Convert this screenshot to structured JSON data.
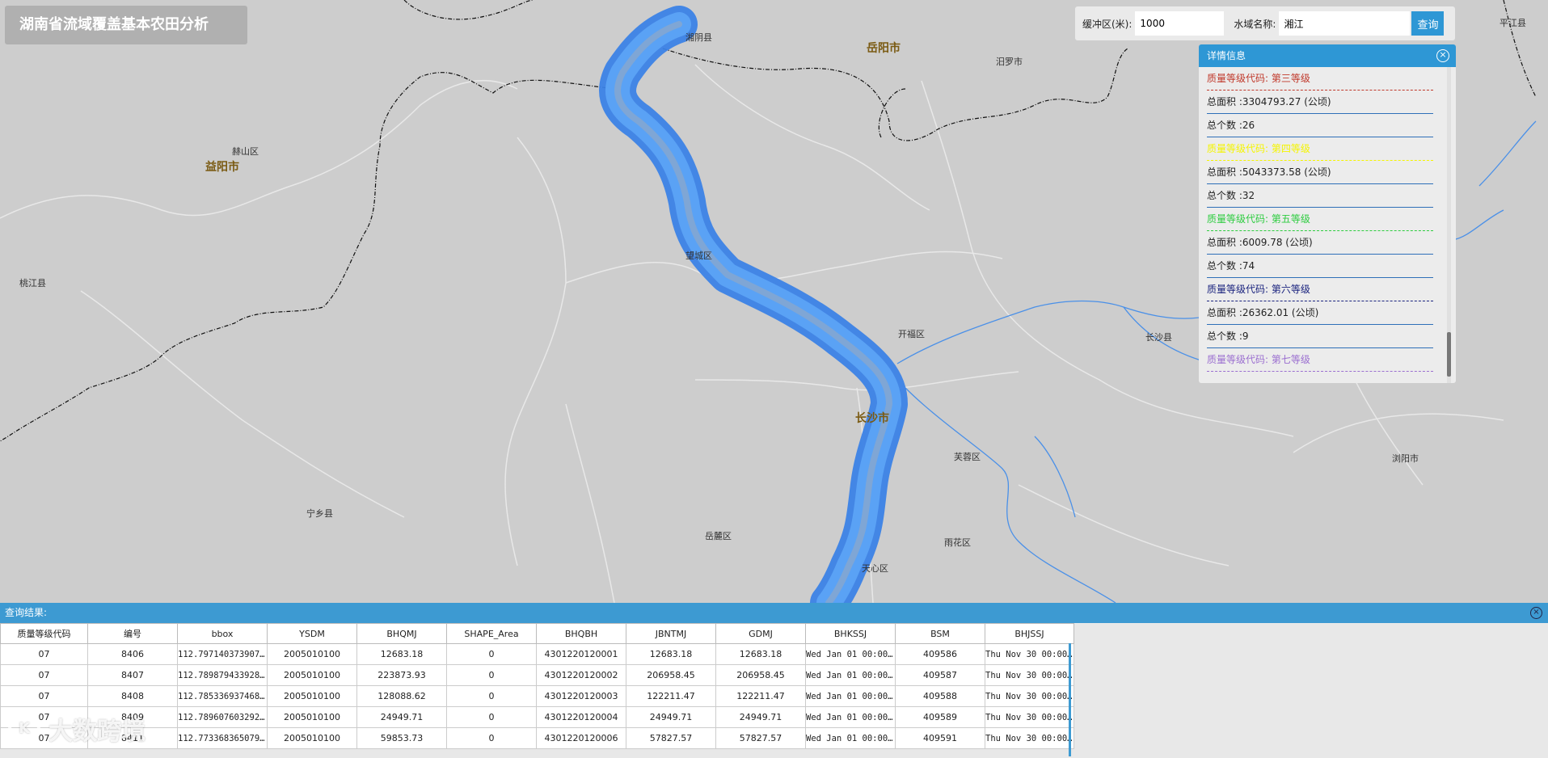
{
  "app": {
    "title": "湖南省流域覆盖基本农田分析"
  },
  "search": {
    "buffer_label": "缓冲区(米):",
    "buffer_value": "1000",
    "water_label": "水域名称:",
    "water_value": "湘江",
    "query_label": "查询"
  },
  "map": {
    "places": [
      {
        "name": "湘阴县",
        "kind": "county"
      },
      {
        "name": "岳阳市",
        "kind": "city"
      },
      {
        "name": "汨罗市",
        "kind": "county"
      },
      {
        "name": "平江县",
        "kind": "county"
      },
      {
        "name": "赫山区",
        "kind": "county"
      },
      {
        "name": "益阳市",
        "kind": "city"
      },
      {
        "name": "桃江县",
        "kind": "county"
      },
      {
        "name": "望城区",
        "kind": "county"
      },
      {
        "name": "开福区",
        "kind": "county"
      },
      {
        "name": "长沙县",
        "kind": "county"
      },
      {
        "name": "长沙市",
        "kind": "city"
      },
      {
        "name": "芙蓉区",
        "kind": "county"
      },
      {
        "name": "浏阳市",
        "kind": "county"
      },
      {
        "name": "宁乡县",
        "kind": "county"
      },
      {
        "name": "岳麓区",
        "kind": "county"
      },
      {
        "name": "雨花区",
        "kind": "county"
      },
      {
        "name": "天心区",
        "kind": "county"
      }
    ],
    "river_color": "#4a90e8",
    "buffer_color": "#2f7fe0"
  },
  "detail": {
    "title": "详情信息",
    "rows": [
      {
        "text": "质量等级代码: 第三等级",
        "color": "#c0392b",
        "grade": true
      },
      {
        "text": "总面积 :3304793.27 (公顷)"
      },
      {
        "text": "总个数 :26"
      },
      {
        "text": "质量等级代码: 第四等级",
        "color": "#f5f500",
        "grade": true
      },
      {
        "text": "总面积 :5043373.58 (公顷)"
      },
      {
        "text": "总个数 :32"
      },
      {
        "text": "质量等级代码: 第五等级",
        "color": "#2ecc40",
        "grade": true
      },
      {
        "text": "总面积 :6009.78 (公顷)"
      },
      {
        "text": "总个数 :74"
      },
      {
        "text": "质量等级代码: 第六等级",
        "color": "#1a237e",
        "grade": true
      },
      {
        "text": "总面积 :26362.01 (公顷)"
      },
      {
        "text": "总个数 :9"
      },
      {
        "text": "质量等级代码: 第七等级",
        "color": "#9b6fd0",
        "grade": true
      }
    ]
  },
  "results": {
    "title": "查询结果:",
    "columns": [
      "质量等级代码",
      "编号",
      "bbox",
      "YSDM",
      "BHQMJ",
      "SHAPE_Area",
      "BHQBH",
      "JBNTMJ",
      "GDMJ",
      "BHKSSJ",
      "BSM",
      "BHJSSJ"
    ],
    "rows": [
      [
        "07",
        "8406",
        "112.797140373907...",
        "2005010100",
        "12683.18",
        "0",
        "4301220120001",
        "12683.18",
        "12683.18",
        "Wed Jan 01 00:00...",
        "409586",
        "Thu Nov 30 00:00..."
      ],
      [
        "07",
        "8407",
        "112.789879433928...",
        "2005010100",
        "223873.93",
        "0",
        "4301220120002",
        "206958.45",
        "206958.45",
        "Wed Jan 01 00:00...",
        "409587",
        "Thu Nov 30 00:00..."
      ],
      [
        "07",
        "8408",
        "112.785336937468...",
        "2005010100",
        "128088.62",
        "0",
        "4301220120003",
        "122211.47",
        "122211.47",
        "Wed Jan 01 00:00...",
        "409588",
        "Thu Nov 30 00:00..."
      ],
      [
        "07",
        "8409",
        "112.789607603292...",
        "2005010100",
        "24949.71",
        "0",
        "4301220120004",
        "24949.71",
        "24949.71",
        "Wed Jan 01 00:00...",
        "409589",
        "Thu Nov 30 00:00..."
      ],
      [
        "07",
        "8411",
        "112.773368365079...",
        "2005010100",
        "59853.73",
        "0",
        "4301220120006",
        "57827.57",
        "57827.57",
        "Wed Jan 01 00:00...",
        "409591",
        "Thu Nov 30 00:00..."
      ]
    ]
  },
  "watermark": {
    "text": "大数跨境"
  }
}
